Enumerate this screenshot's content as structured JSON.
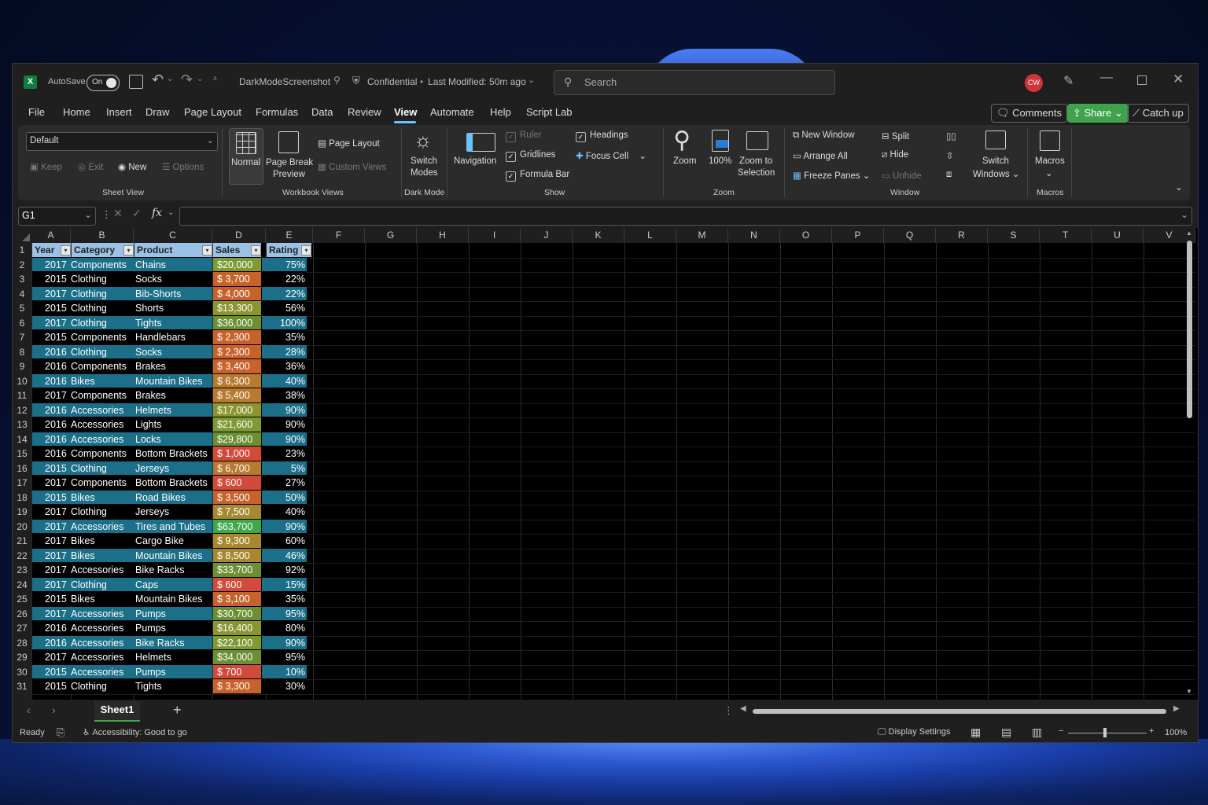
{
  "titlebar": {
    "autosave_label": "AutoSave",
    "autosave_state": "On",
    "filename": "DarkModeScreenshot",
    "sensitivity": "Confidential",
    "modified": "Last Modified: 50m ago",
    "search_placeholder": "Search",
    "avatar": "CW"
  },
  "menu": {
    "items": [
      "File",
      "Home",
      "Insert",
      "Draw",
      "Page Layout",
      "Formulas",
      "Data",
      "Review",
      "View",
      "Automate",
      "Help",
      "Script Lab"
    ],
    "active": "View",
    "comments": "Comments",
    "share": "Share",
    "catchup": "Catch up"
  },
  "ribbon": {
    "sheet_view": {
      "dropdown": "Default",
      "keep": "Keep",
      "exit": "Exit",
      "new": "New",
      "options": "Options",
      "group": "Sheet View"
    },
    "workbook_views": {
      "normal": "Normal",
      "page_break_1": "Page Break",
      "page_break_2": "Preview",
      "page_layout": "Page Layout",
      "custom_views": "Custom Views",
      "group": "Workbook Views"
    },
    "dark_mode": {
      "switch_1": "Switch",
      "switch_2": "Modes",
      "group": "Dark Mode"
    },
    "show": {
      "navigation": "Navigation",
      "ruler": "Ruler",
      "gridlines": "Gridlines",
      "formula_bar": "Formula Bar",
      "headings": "Headings",
      "focus_cell": "Focus Cell",
      "group": "Show"
    },
    "zoom": {
      "zoom": "Zoom",
      "hundred": "100%",
      "zoom_sel_1": "Zoom to",
      "zoom_sel_2": "Selection",
      "group": "Zoom"
    },
    "window": {
      "new_window": "New Window",
      "arrange_all": "Arrange All",
      "freeze_panes": "Freeze Panes",
      "split": "Split",
      "hide": "Hide",
      "unhide": "Unhide",
      "switch_1": "Switch",
      "switch_2": "Windows",
      "group": "Window"
    },
    "macros": {
      "label": "Macros",
      "group": "Macros"
    }
  },
  "formula_bar": {
    "name_box": "G1",
    "fx": "fx",
    "value": ""
  },
  "columns": [
    "A",
    "B",
    "C",
    "D",
    "E",
    "F",
    "G",
    "H",
    "I",
    "J",
    "K",
    "L",
    "M",
    "N",
    "O",
    "P",
    "Q",
    "R",
    "S",
    "T",
    "U",
    "V"
  ],
  "table": {
    "headers": [
      "Year",
      "Category",
      "Product",
      "Sales",
      "Rating"
    ],
    "rows": [
      [
        "2017",
        "Components",
        "Chains",
        "$20,000",
        "75%"
      ],
      [
        "2015",
        "Clothing",
        "Socks",
        "$ 3,700",
        "22%"
      ],
      [
        "2017",
        "Clothing",
        "Bib-Shorts",
        "$ 4,000",
        "22%"
      ],
      [
        "2015",
        "Clothing",
        "Shorts",
        "$13,300",
        "56%"
      ],
      [
        "2017",
        "Clothing",
        "Tights",
        "$36,000",
        "100%"
      ],
      [
        "2015",
        "Components",
        "Handlebars",
        "$ 2,300",
        "35%"
      ],
      [
        "2016",
        "Clothing",
        "Socks",
        "$ 2,300",
        "28%"
      ],
      [
        "2016",
        "Components",
        "Brakes",
        "$ 3,400",
        "36%"
      ],
      [
        "2016",
        "Bikes",
        "Mountain Bikes",
        "$ 6,300",
        "40%"
      ],
      [
        "2017",
        "Components",
        "Brakes",
        "$ 5,400",
        "38%"
      ],
      [
        "2016",
        "Accessories",
        "Helmets",
        "$17,000",
        "90%"
      ],
      [
        "2016",
        "Accessories",
        "Lights",
        "$21,600",
        "90%"
      ],
      [
        "2016",
        "Accessories",
        "Locks",
        "$29,800",
        "90%"
      ],
      [
        "2016",
        "Components",
        "Bottom Brackets",
        "$ 1,000",
        "23%"
      ],
      [
        "2015",
        "Clothing",
        "Jerseys",
        "$ 6,700",
        "5%"
      ],
      [
        "2017",
        "Components",
        "Bottom Brackets",
        "$ 600",
        "27%"
      ],
      [
        "2015",
        "Bikes",
        "Road Bikes",
        "$ 3,500",
        "50%"
      ],
      [
        "2017",
        "Clothing",
        "Jerseys",
        "$ 7,500",
        "40%"
      ],
      [
        "2017",
        "Accessories",
        "Tires and Tubes",
        "$63,700",
        "90%"
      ],
      [
        "2017",
        "Bikes",
        "Cargo Bike",
        "$ 9,300",
        "60%"
      ],
      [
        "2017",
        "Bikes",
        "Mountain Bikes",
        "$ 8,500",
        "46%"
      ],
      [
        "2017",
        "Accessories",
        "Bike Racks",
        "$33,700",
        "92%"
      ],
      [
        "2017",
        "Clothing",
        "Caps",
        "$ 600",
        "15%"
      ],
      [
        "2015",
        "Bikes",
        "Mountain Bikes",
        "$ 3,100",
        "35%"
      ],
      [
        "2017",
        "Accessories",
        "Pumps",
        "$30,700",
        "95%"
      ],
      [
        "2016",
        "Accessories",
        "Pumps",
        "$16,400",
        "80%"
      ],
      [
        "2016",
        "Accessories",
        "Bike Racks",
        "$22,100",
        "90%"
      ],
      [
        "2017",
        "Accessories",
        "Helmets",
        "$34,000",
        "95%"
      ],
      [
        "2015",
        "Accessories",
        "Pumps",
        "$ 700",
        "10%"
      ],
      [
        "2015",
        "Clothing",
        "Tights",
        "$ 3,300",
        "30%"
      ]
    ],
    "sales_colors": [
      "#7d9a35",
      "#c8622b",
      "#c8622b",
      "#8a9530",
      "#6b8f33",
      "#c8622b",
      "#c8622b",
      "#c8622b",
      "#b87a30",
      "#b87a30",
      "#8a9530",
      "#7d9a35",
      "#6b8f33",
      "#d24b3a",
      "#b87a30",
      "#d24b3a",
      "#c8622b",
      "#a8882f",
      "#3fa84a",
      "#a8882f",
      "#a8882f",
      "#6b8f33",
      "#d24b3a",
      "#c8622b",
      "#6b8f33",
      "#8a9530",
      "#7d9a35",
      "#6b8f33",
      "#d24b3a",
      "#c8622b"
    ]
  },
  "sheets": {
    "active": "Sheet1"
  },
  "status": {
    "ready": "Ready",
    "accessibility": "Accessibility: Good to go",
    "display_settings": "Display Settings",
    "zoom": "100%"
  },
  "colors": {
    "table_header": "#9bc2e6",
    "row_band": "#1c6f88",
    "row_band_alt": "#000000",
    "accent": "#3fa34d"
  }
}
